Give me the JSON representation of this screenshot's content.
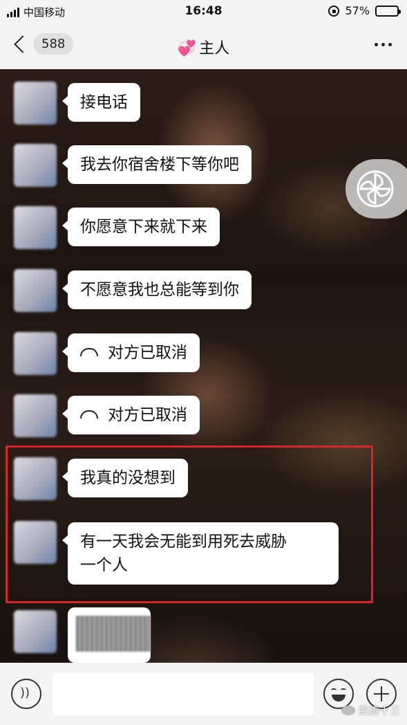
{
  "status_bar": {
    "carrier": "中国移动",
    "time": "16:48",
    "battery_percent": "57%",
    "battery_level": 0.57
  },
  "nav": {
    "back_icon": "chevron-left-icon",
    "unread_count": "588",
    "title": "主人",
    "title_icon": "sparkling-hearts-emoji",
    "more_icon": "more-dots-icon"
  },
  "messages": [
    {
      "text": "接电话"
    },
    {
      "text": "我去你宿舍楼下等你吧"
    },
    {
      "text": "你愿意下来就下来"
    },
    {
      "text": "不愿意我也总能等到你"
    },
    {
      "text": "对方已取消",
      "icon": "hangup-icon"
    },
    {
      "text": "对方已取消",
      "icon": "hangup-icon"
    },
    {
      "text": "我真的没想到"
    },
    {
      "text": "有一天我会无能到用死去威胁",
      "text2": "一个人"
    }
  ],
  "input_bar": {
    "placeholder": "",
    "voice_icon": "voice-icon",
    "emoji_icon": "emoji-icon",
    "plus_icon": "plus-icon"
  },
  "watermark": {
    "text": "凯旋十三"
  },
  "colors": {
    "highlight": "#d7262c",
    "bubble": "#ffffff",
    "bar_background": "#f4f4f4"
  }
}
